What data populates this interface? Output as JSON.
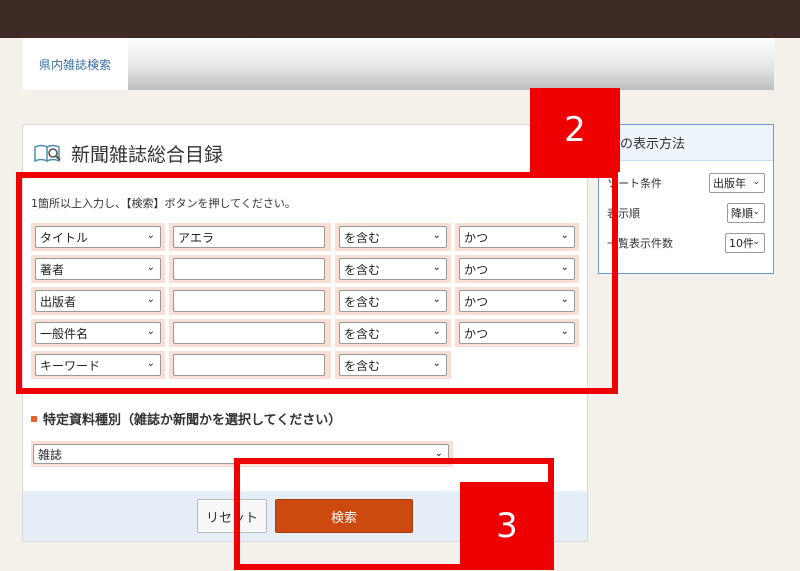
{
  "header": {
    "tab_label": "県内雑誌検索"
  },
  "panel": {
    "title": "新聞雑誌総合目録",
    "instruction": "1箇所以上入力し、【検索】ボタンを押してください。",
    "rows": [
      {
        "field": "タイトル",
        "value": "アエラ",
        "match": "を含む",
        "logic": "かつ"
      },
      {
        "field": "著者",
        "value": "",
        "match": "を含む",
        "logic": "かつ"
      },
      {
        "field": "出版者",
        "value": "",
        "match": "を含む",
        "logic": "かつ"
      },
      {
        "field": "一般件名",
        "value": "",
        "match": "を含む",
        "logic": "かつ"
      },
      {
        "field": "キーワード",
        "value": "",
        "match": "を含む",
        "logic": ""
      }
    ],
    "material_heading": "特定資料種別（雑誌か新聞かを選択してください）",
    "material_value": "雑誌",
    "reset_label": "リセット",
    "search_label": "検索"
  },
  "side": {
    "title": "果の表示方法",
    "sort_label": "ソート条件",
    "sort_value": "出版年",
    "order_label": "表示順",
    "order_value": "降順",
    "count_label": "一覧表示件数",
    "count_value": "10件"
  },
  "annotations": {
    "label_2": "2",
    "label_3": "3"
  },
  "colors": {
    "accent": "#cc4a10",
    "highlight": "#ee0000",
    "cell_bg": "#f9dfd5",
    "header_bg": "#3e2b25"
  }
}
